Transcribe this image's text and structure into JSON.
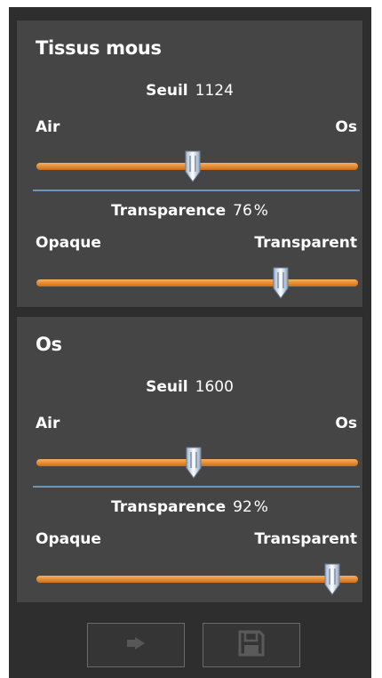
{
  "sections": [
    {
      "title": "Tissus mous",
      "threshold_label": "Seuil",
      "threshold_value": "1124",
      "threshold_left": "Air",
      "threshold_right": "Os",
      "threshold_fraction": 0.485,
      "transparency_label": "Transparence",
      "transparency_value": "76",
      "transparency_unit": "%",
      "transparency_left": "Opaque",
      "transparency_right": "Transparent",
      "transparency_fraction": 0.76
    },
    {
      "title": "Os",
      "threshold_label": "Seuil",
      "threshold_value": "1600",
      "threshold_left": "Air",
      "threshold_right": "Os",
      "threshold_fraction": 0.49,
      "transparency_label": "Transparence",
      "transparency_value": "92",
      "transparency_unit": "%",
      "transparency_left": "Opaque",
      "transparency_right": "Transparent",
      "transparency_fraction": 0.92
    }
  ],
  "buttons": [
    {
      "icon": "arrow-right-icon",
      "enabled": false
    },
    {
      "icon": "save-disk-icon",
      "enabled": false
    }
  ],
  "colors": {
    "panel_bg": "#2e2e2e",
    "section_bg": "#454545",
    "slider_track": "#e5862a",
    "separator": "#6f93b8",
    "text": "#ffffff"
  }
}
